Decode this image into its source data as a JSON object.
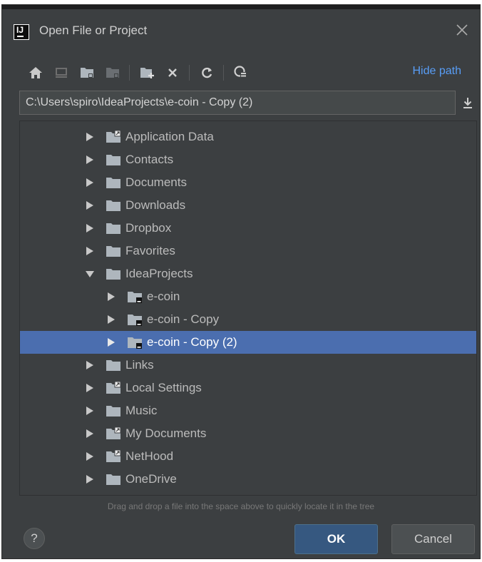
{
  "window": {
    "title": "Open File or Project"
  },
  "toolbar": {
    "buttons": [
      "home-icon",
      "desktop-icon",
      "project-folder-icon",
      "module-folder-icon",
      "new-folder-icon",
      "delete-icon",
      "refresh-icon",
      "show-hidden-icon"
    ],
    "hide_path_label": "Hide path"
  },
  "path": {
    "value": "C:\\Users\\spiro\\IdeaProjects\\e-coin - Copy (2)"
  },
  "tree": {
    "items": [
      {
        "label": "Application Data",
        "icon": "shortcut-folder-icon",
        "expanded": false,
        "selected": false
      },
      {
        "label": "Contacts",
        "icon": "folder-icon",
        "expanded": false,
        "selected": false
      },
      {
        "label": "Documents",
        "icon": "folder-icon",
        "expanded": false,
        "selected": false
      },
      {
        "label": "Downloads",
        "icon": "folder-icon",
        "expanded": false,
        "selected": false
      },
      {
        "label": "Dropbox",
        "icon": "folder-icon",
        "expanded": false,
        "selected": false
      },
      {
        "label": "Favorites",
        "icon": "folder-icon",
        "expanded": false,
        "selected": false
      },
      {
        "label": "IdeaProjects",
        "icon": "folder-icon",
        "expanded": true,
        "selected": false
      },
      {
        "label": "e-coin",
        "icon": "project-folder-icon",
        "expanded": false,
        "selected": false
      },
      {
        "label": "e-coin - Copy",
        "icon": "project-folder-icon",
        "expanded": false,
        "selected": false
      },
      {
        "label": "e-coin - Copy (2)",
        "icon": "project-folder-icon",
        "expanded": false,
        "selected": true
      },
      {
        "label": "Links",
        "icon": "folder-icon",
        "expanded": false,
        "selected": false
      },
      {
        "label": "Local Settings",
        "icon": "shortcut-folder-icon",
        "expanded": false,
        "selected": false
      },
      {
        "label": "Music",
        "icon": "folder-icon",
        "expanded": false,
        "selected": false
      },
      {
        "label": "My Documents",
        "icon": "shortcut-folder-icon",
        "expanded": false,
        "selected": false
      },
      {
        "label": "NetHood",
        "icon": "shortcut-folder-icon",
        "expanded": false,
        "selected": false
      },
      {
        "label": "OneDrive",
        "icon": "folder-icon",
        "expanded": false,
        "selected": false
      }
    ],
    "hint": "Drag and drop a file into the space above to quickly locate it in the tree"
  },
  "footer": {
    "help_label": "?",
    "ok_label": "OK",
    "cancel_label": "Cancel"
  },
  "colors": {
    "background": "#3c3f41",
    "selection": "#4b6eaf",
    "link": "#589df6",
    "ok_button": "#365880"
  }
}
